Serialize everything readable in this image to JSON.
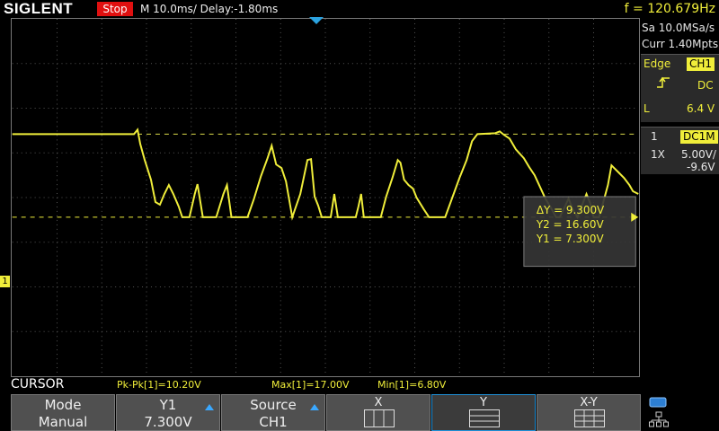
{
  "header": {
    "brand": "SIGLENT",
    "run_status": "Stop",
    "timebase": "M 10.0ms/ Delay:-1.80ms",
    "frequency": "f = 120.679Hz"
  },
  "acquisition": {
    "sample_rate": "Sa 10.0MSa/s",
    "memory_depth": "Curr 1.40Mpts"
  },
  "trigger": {
    "type_label": "Edge",
    "source": "CH1",
    "coupling": "DC",
    "level_prefix": "L",
    "level": "6.4 V"
  },
  "channel": {
    "number": "1",
    "coupling_impedance": "DC1M",
    "probe": "1X",
    "scale": "5.00V/",
    "offset": "-9.6V",
    "ground_marker": "1"
  },
  "cursor_readout": {
    "delta": "ΔY = 9.300V",
    "y2": "Y2 = 16.60V",
    "y1": "Y1 = 7.300V"
  },
  "menu_title": "CURSOR",
  "measurements": [
    "Pk-Pk[1]=10.20V",
    "Max[1]=17.00V",
    "Min[1]=6.80V"
  ],
  "softkeys": {
    "mode": {
      "l1": "Mode",
      "l2": "Manual"
    },
    "y1": {
      "l1": "Y1",
      "l2": "7.300V"
    },
    "source": {
      "l1": "Source",
      "l2": "CH1"
    },
    "x": {
      "l1": "X"
    },
    "y": {
      "l1": "Y"
    },
    "xy": {
      "l1": "X-Y"
    }
  },
  "colors": {
    "trace": "#f0ee3a",
    "stop": "#e01010",
    "accent": "#3aa8ff"
  }
}
